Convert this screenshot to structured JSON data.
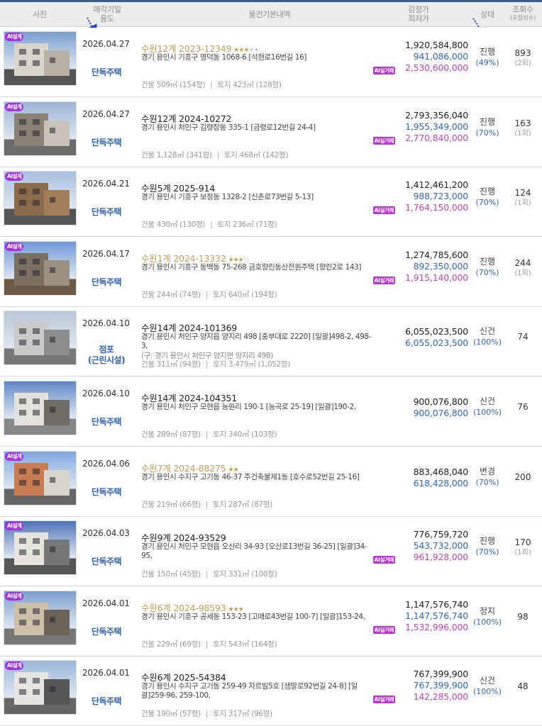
{
  "header": {
    "photo": "사진",
    "date_line1": "매각기일",
    "date_line2": "용도",
    "info": "물건기본내역",
    "price_line1": "감정가",
    "price_line2": "최저가",
    "status": "상태",
    "views_line1": "조회수",
    "views_line2": "(유찰회수)"
  },
  "colors": {
    "accent_blue": "#2f66c2",
    "sale_pink": "#c044b8",
    "gold": "#c49d4f",
    "badge_purple": "#a232e0"
  },
  "rows": [
    {
      "badge": "AI설계",
      "date": "2026.04.27",
      "use": "단독주택",
      "case": "수원12계 2023-12349",
      "gold": true,
      "stars_on": "★★★",
      "stars_off": "★★",
      "addr": "경기 용인시 기흥구 영덕동 1068-6 [석현로16번길 16]",
      "addr2": "",
      "building": "건물 509㎡ (154평)",
      "land": "토지 423㎡ (128평)",
      "ai_label": "AI실거래",
      "appraisal": "1,920,584,800",
      "minimum": "941,086,000",
      "sale_price": "2,530,600,000",
      "status": "진행",
      "pct": "(49%)",
      "views": "893",
      "fails": "(2회)"
    },
    {
      "badge": "AI설계",
      "date": "2026.04.27",
      "use": "단독주택",
      "case": "수원12계 2024-10272",
      "gold": false,
      "stars_on": "",
      "stars_off": "",
      "addr": "경기 용인시 처인구 김량장동 335-1 [금령로12번길 24-4]",
      "addr2": "",
      "building": "건물 1,128㎡ (341평)",
      "land": "토지 468㎡ (142평)",
      "ai_label": "AI실거래",
      "appraisal": "2,793,356,040",
      "minimum": "1,955,349,000",
      "sale_price": "2,770,840,000",
      "status": "진행",
      "pct": "(70%)",
      "views": "163",
      "fails": "(1회)"
    },
    {
      "badge": "AI설계",
      "date": "2026.04.21",
      "use": "단독주택",
      "case": "수원5계 2025-914",
      "gold": false,
      "stars_on": "",
      "stars_off": "",
      "addr": "경기 용인시 기흥구 보정동 1328-2 [신촌로73번길 5-13]",
      "addr2": "",
      "building": "건물 430㎡ (130평)",
      "land": "토지 236㎡ (71평)",
      "ai_label": "AI실거래",
      "appraisal": "1,412,461,200",
      "minimum": "988,723,000",
      "sale_price": "1,764,150,000",
      "status": "진행",
      "pct": "(70%)",
      "views": "124",
      "fails": "(1회)"
    },
    {
      "badge": "AI설계",
      "date": "2026.04.17",
      "use": "단독주택",
      "case": "수원1계 2024-13332",
      "gold": true,
      "stars_on": "★★★",
      "stars_off": "½",
      "addr": "경기 용인시 기흥구 동백동 75-268 금호향린동산전원주택 [향린2로 143]",
      "addr2": "",
      "building": "건물 244㎡ (74평)",
      "land": "토지 640㎡ (194평)",
      "ai_label": "AI실거래",
      "appraisal": "1,274,785,600",
      "minimum": "892,350,000",
      "sale_price": "1,915,140,000",
      "status": "진행",
      "pct": "(70%)",
      "views": "244",
      "fails": "(1회)"
    },
    {
      "badge": "",
      "date": "2026.04.10",
      "use": "점포\n(근린시설)",
      "case": "수원14계 2024-101369",
      "gold": false,
      "stars_on": "",
      "stars_off": "",
      "addr": "경기 용인시 처인구 양지읍 양지리 498 [중부대로 2220] [일괄]498-2, 498-3,",
      "addr2": "(구: 경기 용인시 처인구 양지면 양지리 498)",
      "building": "건물 311㎡ (94평)",
      "land": "토지 3,479㎡ (1,052평)",
      "ai_label": "",
      "appraisal": "6,055,023,500",
      "minimum": "6,055,023,500",
      "sale_price": "",
      "status": "신건",
      "pct": "(100%)",
      "views": "74",
      "fails": ""
    },
    {
      "badge": "",
      "date": "2026.04.10",
      "use": "단독주택",
      "case": "수원14계 2024-104351",
      "gold": false,
      "stars_on": "",
      "stars_off": "",
      "addr": "경기 용인시 처인구 모현읍 능원리 190-1 [능곡로 25-19] [일괄]190-2,",
      "addr2": "",
      "building": "건물 289㎡ (87평)",
      "land": "토지 340㎡ (103평)",
      "ai_label": "",
      "appraisal": "900,076,800",
      "minimum": "900,076,800",
      "sale_price": "",
      "status": "신건",
      "pct": "(100%)",
      "views": "76",
      "fails": ""
    },
    {
      "badge": "AI설계",
      "date": "2026.04.06",
      "use": "단독주택",
      "case": "수원7계 2024-88275",
      "gold": true,
      "stars_on": "★★",
      "stars_off": "",
      "addr": "경기 용인시 수지구 고기동 46-37 주건축물제1동 [호수로52번길 25-16]",
      "addr2": "",
      "building": "건물 219㎡ (66평)",
      "land": "토지 287㎡ (87평)",
      "ai_label": "",
      "appraisal": "883,468,040",
      "minimum": "618,428,000",
      "sale_price": "",
      "status": "변경",
      "pct": "(70%)",
      "views": "200",
      "fails": ""
    },
    {
      "badge": "AI설계",
      "date": "2026.04.03",
      "use": "단독주택",
      "case": "수원9계 2024-93529",
      "gold": false,
      "stars_on": "",
      "stars_off": "",
      "addr": "경기 용인시 처인구 모현읍 오산리 34-93 [오산로13번길 36-25] [일괄]34-95,",
      "addr2": "",
      "building": "건물 150㎡ (45평)",
      "land": "토지 331㎡ (100평)",
      "ai_label": "AI실거래",
      "appraisal": "776,759,720",
      "minimum": "543,732,000",
      "sale_price": "961,928,000",
      "status": "진행",
      "pct": "(70%)",
      "views": "170",
      "fails": "(1회)"
    },
    {
      "badge": "AI설계",
      "date": "2026.04.01",
      "use": "단독주택",
      "case": "수원6계 2024-98593",
      "gold": true,
      "stars_on": "★★★",
      "stars_off": "",
      "addr": "경기 용인시 기흥구 공세동 153-23 [고매로43번길 100-7] [일괄]153-24,",
      "addr2": "",
      "building": "건물 229㎡ (69평)",
      "land": "토지 543㎡ (164평)",
      "ai_label": "AI실거래",
      "appraisal": "1,147,576,740",
      "minimum": "1,147,576,740",
      "sale_price": "1,532,996,000",
      "status": "정지",
      "pct": "(100%)",
      "views": "98",
      "fails": ""
    },
    {
      "badge": "AI설계",
      "date": "2026.04.01",
      "use": "단독주택",
      "case": "수원6계 2025-54384",
      "gold": false,
      "stars_on": "",
      "stars_off": "",
      "addr": "경기 용인시 수지구 고기동 259-49 자르빌5호 [샘말로92번길 24-8] [일괄]259-96, 259-100,",
      "addr2": "",
      "building": "건물 190㎡ (57평)",
      "land": "토지 317㎡ (96평)",
      "ai_label": "AI실거래",
      "appraisal": "767,399,900",
      "minimum": "767,399,900",
      "sale_price": "142,285,000",
      "status": "신건",
      "pct": "(100%)",
      "views": "48",
      "fails": ""
    }
  ]
}
